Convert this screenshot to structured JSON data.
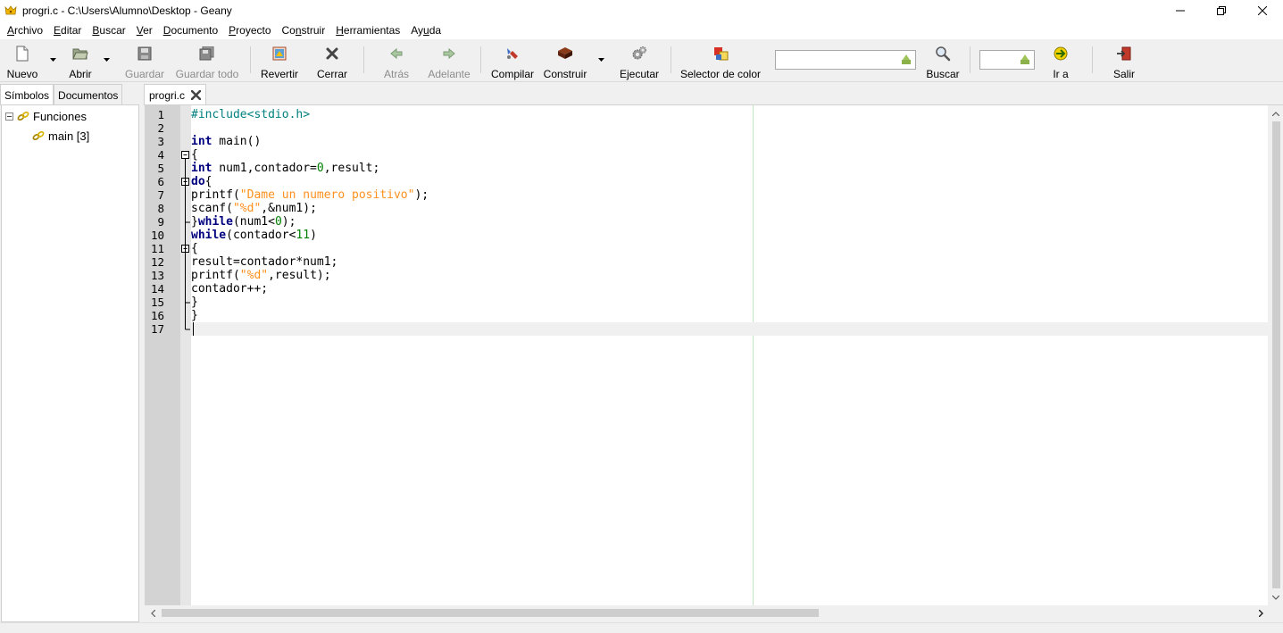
{
  "window": {
    "title": "progri.c - C:\\Users\\Alumno\\Desktop - Geany",
    "controls": [
      "minimize-icon",
      "restore-icon",
      "close-icon"
    ]
  },
  "menu": [
    {
      "mnemonic": "A",
      "rest": "rchivo"
    },
    {
      "mnemonic": "E",
      "rest": "ditar"
    },
    {
      "mnemonic": "B",
      "rest": "uscar"
    },
    {
      "mnemonic": "V",
      "rest": "er"
    },
    {
      "mnemonic": "D",
      "rest": "ocumento"
    },
    {
      "mnemonic": "P",
      "rest": "royecto"
    },
    {
      "pre": "Co",
      "mnemonic": "n",
      "rest": "struir"
    },
    {
      "mnemonic": "H",
      "rest": "erramientas"
    },
    {
      "pre": "Ay",
      "mnemonic": "u",
      "rest": "da"
    }
  ],
  "toolbar": {
    "nuevo": "Nuevo",
    "abrir": "Abrir",
    "guardar": "Guardar",
    "guardar_todo": "Guardar todo",
    "revertir": "Revertir",
    "cerrar": "Cerrar",
    "atras": "Atrás",
    "adelante": "Adelante",
    "compilar": "Compilar",
    "construir": "Construir",
    "ejecutar": "Ejecutar",
    "selector_color": "Selector de color",
    "search_value": "",
    "buscar": "Buscar",
    "goto_value": "",
    "ir_a": "Ir a",
    "salir": "Salir"
  },
  "sidebar": {
    "tabs": [
      "Símbolos",
      "Documentos"
    ],
    "active_tab": 0,
    "tree": {
      "group": "Funciones",
      "items": [
        "main [3]"
      ]
    }
  },
  "editor": {
    "tab": "progri.c",
    "current_line": 17,
    "lines": [
      [
        {
          "t": "#include<stdio.h>",
          "c": "pp"
        }
      ],
      [],
      [
        {
          "t": "int",
          "c": "kw"
        },
        {
          "t": " main()"
        }
      ],
      [
        {
          "t": "{"
        }
      ],
      [
        {
          "t": "int",
          "c": "kw"
        },
        {
          "t": " num1,contador="
        },
        {
          "t": "0",
          "c": "num"
        },
        {
          "t": ",result;"
        }
      ],
      [
        {
          "t": "do",
          "c": "kw"
        },
        {
          "t": "{"
        }
      ],
      [
        {
          "t": "printf("
        },
        {
          "t": "\"Dame un numero positivo\"",
          "c": "str"
        },
        {
          "t": ");"
        }
      ],
      [
        {
          "t": "scanf("
        },
        {
          "t": "\"%d\"",
          "c": "str"
        },
        {
          "t": ",&num1);"
        }
      ],
      [
        {
          "t": "}"
        },
        {
          "t": "while",
          "c": "kw"
        },
        {
          "t": "(num1<"
        },
        {
          "t": "0",
          "c": "num"
        },
        {
          "t": ");"
        }
      ],
      [
        {
          "t": "while",
          "c": "kw"
        },
        {
          "t": "(contador<"
        },
        {
          "t": "11",
          "c": "num"
        },
        {
          "t": ")"
        }
      ],
      [
        {
          "t": "{"
        }
      ],
      [
        {
          "t": "result=contador*num1;"
        }
      ],
      [
        {
          "t": "printf("
        },
        {
          "t": "\"%d\"",
          "c": "str"
        },
        {
          "t": ",result);"
        }
      ],
      [
        {
          "t": "contador++;"
        }
      ],
      [
        {
          "t": "}"
        }
      ],
      [
        {
          "t": "}"
        }
      ],
      []
    ]
  }
}
